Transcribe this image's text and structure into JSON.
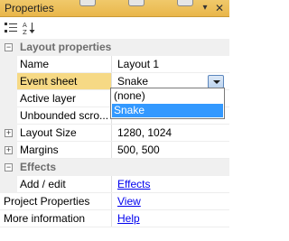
{
  "panel": {
    "title": "Properties"
  },
  "toolbar": {
    "sort_categorized_icon": "categorized-list-icon",
    "sort_alpha_icon": "sort-az-icon"
  },
  "categories": {
    "layout": "Layout properties",
    "effects": "Effects"
  },
  "rows": {
    "name": {
      "label": "Name",
      "value": "Layout 1"
    },
    "event_sheet": {
      "label": "Event sheet",
      "value": "Snake"
    },
    "active_layer": {
      "label": "Active layer",
      "value": ""
    },
    "unbounded": {
      "label": "Unbounded scro..."
    },
    "layout_size": {
      "label": "Layout Size",
      "value": "1280, 1024"
    },
    "margins": {
      "label": "Margins",
      "value": "500, 500"
    },
    "add_edit": {
      "label": "Add / edit",
      "value": "Effects"
    },
    "project_props": {
      "label": "Project Properties",
      "value": "View"
    },
    "more_info": {
      "label": "More information",
      "value": "Help"
    }
  },
  "dropdown": {
    "options": [
      "(none)",
      "Snake"
    ],
    "selected": "Snake"
  },
  "colors": {
    "titlebar": "#e9b64a",
    "selection": "#3399ff",
    "selected_row": "#f6d985",
    "link": "#0000ee"
  }
}
